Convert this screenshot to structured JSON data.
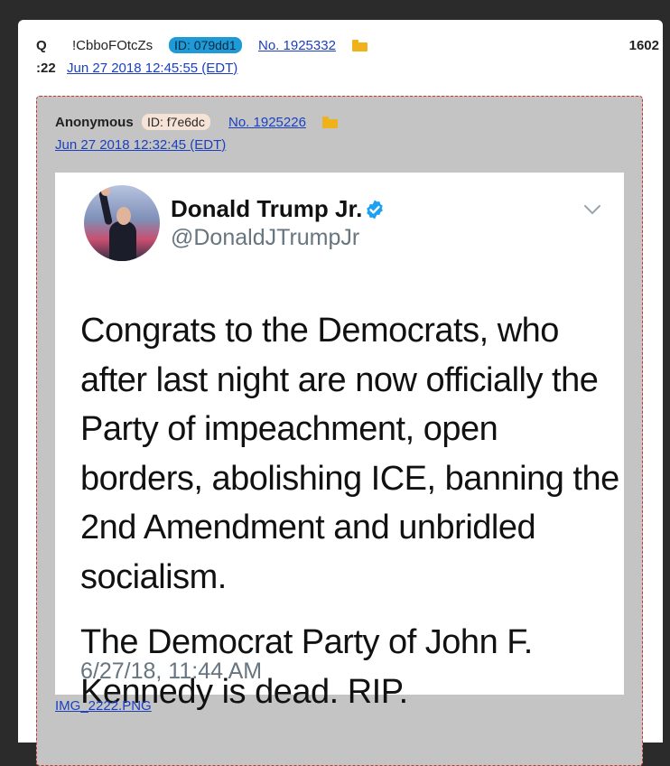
{
  "post": {
    "name": "Q",
    "tripcode": "!CbboFOtcZs",
    "id_label": "ID: 079dd1",
    "post_number": "No. 1925332",
    "counter": "1602",
    "time_prefix": ":22",
    "timestamp": "Jun 27 2018 12:45:55 (EDT)",
    "colors": {
      "id_badge": "#1e9bd7",
      "link": "#1a3fbf",
      "folder": "#f0b21a"
    }
  },
  "quoted": {
    "name": "Anonymous",
    "id_label": "ID: f7e6dc",
    "post_number": "No. 1925226",
    "timestamp": "Jun 27 2018 12:32:45 (EDT)",
    "filename": "IMG_2222.PNG",
    "tweet": {
      "display_name": "Donald Trump Jr.",
      "handle": "@DonaldJTrumpJr",
      "paragraph1": "Congrats to the Democrats, who after last night are now officially the Party of impeachment, open borders, abolishing ICE, banning the 2nd Amendment and unbridled socialism.",
      "paragraph2": "The Democrat Party of John F. Kennedy is dead. RIP.",
      "date": "6/27/18, 11:44 AM",
      "icons": [
        "verified-icon",
        "chevron-down-icon"
      ]
    }
  }
}
